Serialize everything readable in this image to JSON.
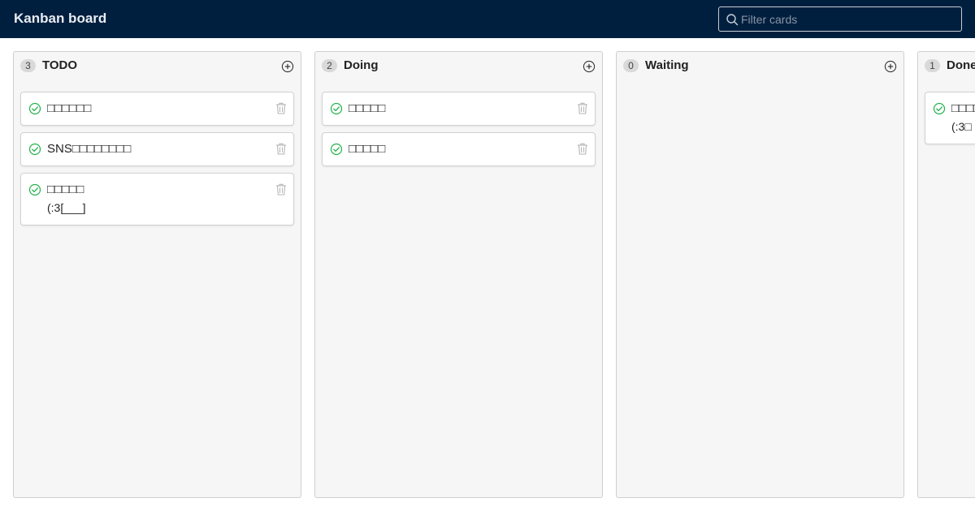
{
  "app": {
    "title": "Kanban board",
    "filter_placeholder": "Filter cards",
    "header_bg": "#001f3f"
  },
  "icons": {
    "search": "search-icon",
    "add": "plus-circle-icon",
    "check": "check-circle-icon",
    "delete": "trash-icon"
  },
  "colors": {
    "check": "#22b14c",
    "trash": "#b5b5b5",
    "column_bg": "#f6f6f6"
  },
  "columns": [
    {
      "title": "TODO",
      "count": "3",
      "cards": [
        {
          "title": "□□□□□□"
        },
        {
          "title": "SNS□□□□□□□□"
        },
        {
          "title": "□□□□□",
          "note": "(:3[___]"
        }
      ]
    },
    {
      "title": "Doing",
      "count": "2",
      "cards": [
        {
          "title": "□□□□□"
        },
        {
          "title": "□□□□□"
        }
      ]
    },
    {
      "title": "Waiting",
      "count": "0",
      "cards": []
    },
    {
      "title": "Done",
      "count": "1",
      "cards": [
        {
          "title": "□□□□□",
          "note": "(:3□"
        }
      ]
    }
  ]
}
